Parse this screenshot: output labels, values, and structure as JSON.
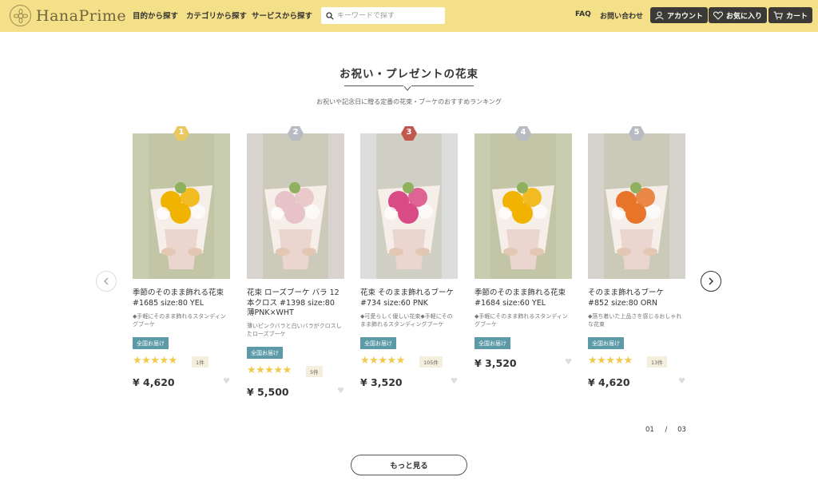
{
  "header": {
    "logo_text": "HanaPrime",
    "nav": [
      "目的から探す",
      "カテゴリから探す",
      "サービスから探す"
    ],
    "search_placeholder": "キーワードで探す",
    "links": [
      "FAQ",
      "お問い合わせ"
    ],
    "buttons": [
      {
        "label": "アカウント",
        "icon": "person-icon"
      },
      {
        "label": "お気に入り",
        "icon": "heart-icon"
      },
      {
        "label": "カート",
        "icon": "cart-icon"
      }
    ],
    "color": "#f5e08a"
  },
  "section": {
    "title": "お祝い・プレゼントの花束",
    "subtitle": "お祝いや記念日に贈る定番の花束・ブーケのおすすめランキング"
  },
  "products": [
    {
      "rank": "1",
      "rank_color": "#e8c860",
      "name": "季節のそのまま飾れる花束 #1685 size:80 YEL",
      "desc": "◆手軽にそのまま飾れるスタンディングブーケ",
      "badge": "全国お届け",
      "stars": "★★★★★",
      "reviews": "1件",
      "price": "¥ 4,620",
      "photo_bg": "#c9cdb0",
      "flower": "#f0b400"
    },
    {
      "rank": "2",
      "rank_color": "#b8bcc2",
      "name": "花束 ローズブーケ バラ 12本クロス #1398 size:80 薄PNK×WHT",
      "desc": "薄いピンクバラと白いバラがクロスしたローズブーケ",
      "badge": "全国お届け",
      "stars": "★★★★★",
      "reviews": "5件",
      "price": "¥ 5,500",
      "photo_bg": "#d8d3cf",
      "flower": "#e7c2c6"
    },
    {
      "rank": "3",
      "rank_color": "#c0584f",
      "name": "花束 そのまま飾れるブーケ #734 size:60 PNK",
      "desc": "◆可愛らしく優しい花束◆手軽にそのまま飾れるスタンディングブーケ",
      "badge": "全国お届け",
      "stars": "★★★★★",
      "reviews": "105件",
      "price": "¥ 3,520",
      "photo_bg": "#dcdcdc",
      "flower": "#d94b85"
    },
    {
      "rank": "4",
      "rank_color": "#b8bcc2",
      "name": "季節のそのまま飾れる花束 #1684 size:60 YEL",
      "desc": "◆手軽にそのまま飾れるスタンディングブーケ",
      "badge": "全国お届け",
      "stars": "",
      "reviews": "",
      "price": "¥ 3,520",
      "photo_bg": "#c9cdb0",
      "flower": "#f2b200"
    },
    {
      "rank": "5",
      "rank_color": "#b8bcc2",
      "name": "そのまま飾れるブーケ #852 size:80 ORN",
      "desc": "◆落ち着いた上品さを感じるおしゃれな花束",
      "badge": "全国お届け",
      "stars": "★★★★★",
      "reviews": "13件",
      "price": "¥ 4,620",
      "photo_bg": "#d6d3cc",
      "flower": "#e8742a"
    }
  ],
  "pager": {
    "current": "01",
    "sep": "/",
    "total": "03"
  },
  "more_label": "もっと見る"
}
